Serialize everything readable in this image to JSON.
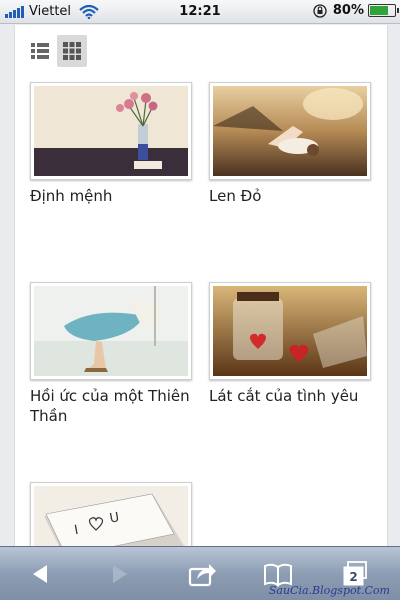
{
  "status_bar": {
    "carrier": "Viettel",
    "time": "12:21",
    "battery_percent": "80%",
    "battery_level": 0.8,
    "signal_icon": "signal-bars-icon",
    "wifi_icon": "wifi-icon",
    "lock_icon": "orientation-lock-icon"
  },
  "view_toggle": {
    "options": [
      {
        "icon": "list-view-icon",
        "active": false
      },
      {
        "icon": "grid-view-icon",
        "active": true
      }
    ]
  },
  "gallery": {
    "items": [
      {
        "title": "Định mệnh",
        "image": "flowers-in-vase-photo"
      },
      {
        "title": "Len Đỏ",
        "image": "girl-lying-in-field-photo"
      },
      {
        "title": "Hồi ức của một Thiên Thần",
        "image": "girl-on-swing-photo"
      },
      {
        "title": "Lát cắt của tình yêu",
        "image": "hearts-in-jars-photo"
      },
      {
        "title": "",
        "image": "i-love-u-note-photo"
      }
    ]
  },
  "toolbar": {
    "back_icon": "back-arrow-icon",
    "forward_icon": "forward-arrow-icon",
    "share_icon": "share-icon",
    "bookmarks_icon": "bookmarks-icon",
    "tabs_icon": "tabs-icon",
    "tabs_count": "2"
  },
  "watermark": "SauCia.Blogspot.Com",
  "colors": {
    "toolbar": "#8d9db3",
    "signal": "#1f5fb8",
    "battery": "#2ea43a",
    "watermark": "#2a3b8f"
  }
}
